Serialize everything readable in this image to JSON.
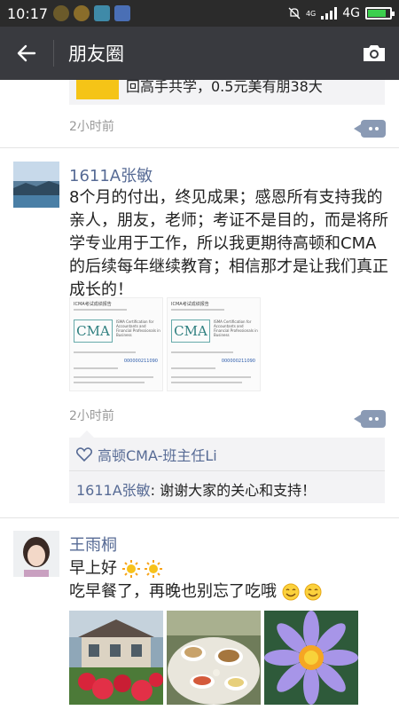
{
  "status_bar": {
    "time": "10:17",
    "network": "4G",
    "network_small": "4G",
    "battery_level": 0.85
  },
  "header": {
    "title": "朋友圈",
    "back_icon": "arrow-left-icon",
    "camera_icon": "camera-icon"
  },
  "previous_post": {
    "time_ago": "2小时前",
    "cut_text": "回高手共学，0.5元美有朋38大"
  },
  "post1": {
    "author": "1611A张敏",
    "text": "8个月的付出，终见成果；感恩所有支持我的亲人，朋友，老师；考证不是目的，而是将所学专业用于工作，所以我更期待高顿和CMA的后续每年继续教育；相信那才是让我们真正成长的！",
    "time_ago": "2小时前",
    "images": [
      {
        "title": "ICMA考试成绩报告",
        "logo": "CMA",
        "subtitle": "ISMA Certification for Accountants and Financial Professionals in Business",
        "number": "000000211090"
      },
      {
        "title": "ICMA考试成绩报告",
        "logo": "CMA",
        "subtitle": "ISMA Certification for Accountants and Financial Professionals in Business",
        "number": "000000211090"
      }
    ],
    "likes": "高顿CMA-班主任Li",
    "comment": {
      "author": "1611A张敏",
      "separator": ": ",
      "text": "谢谢大家的关心和支持！"
    }
  },
  "post2": {
    "author": "王雨桐",
    "line1": "早上好",
    "line2": "吃早餐了，再晚也别忘了吃哦",
    "photos": [
      "garden-house-photo",
      "breakfast-table-photo",
      "purple-lotus-photo"
    ]
  },
  "colors": {
    "name_blue": "#576b95",
    "header_bg": "#393a3f",
    "status_bg": "#2b2b2b",
    "panel_bg": "#f3f3f5"
  }
}
